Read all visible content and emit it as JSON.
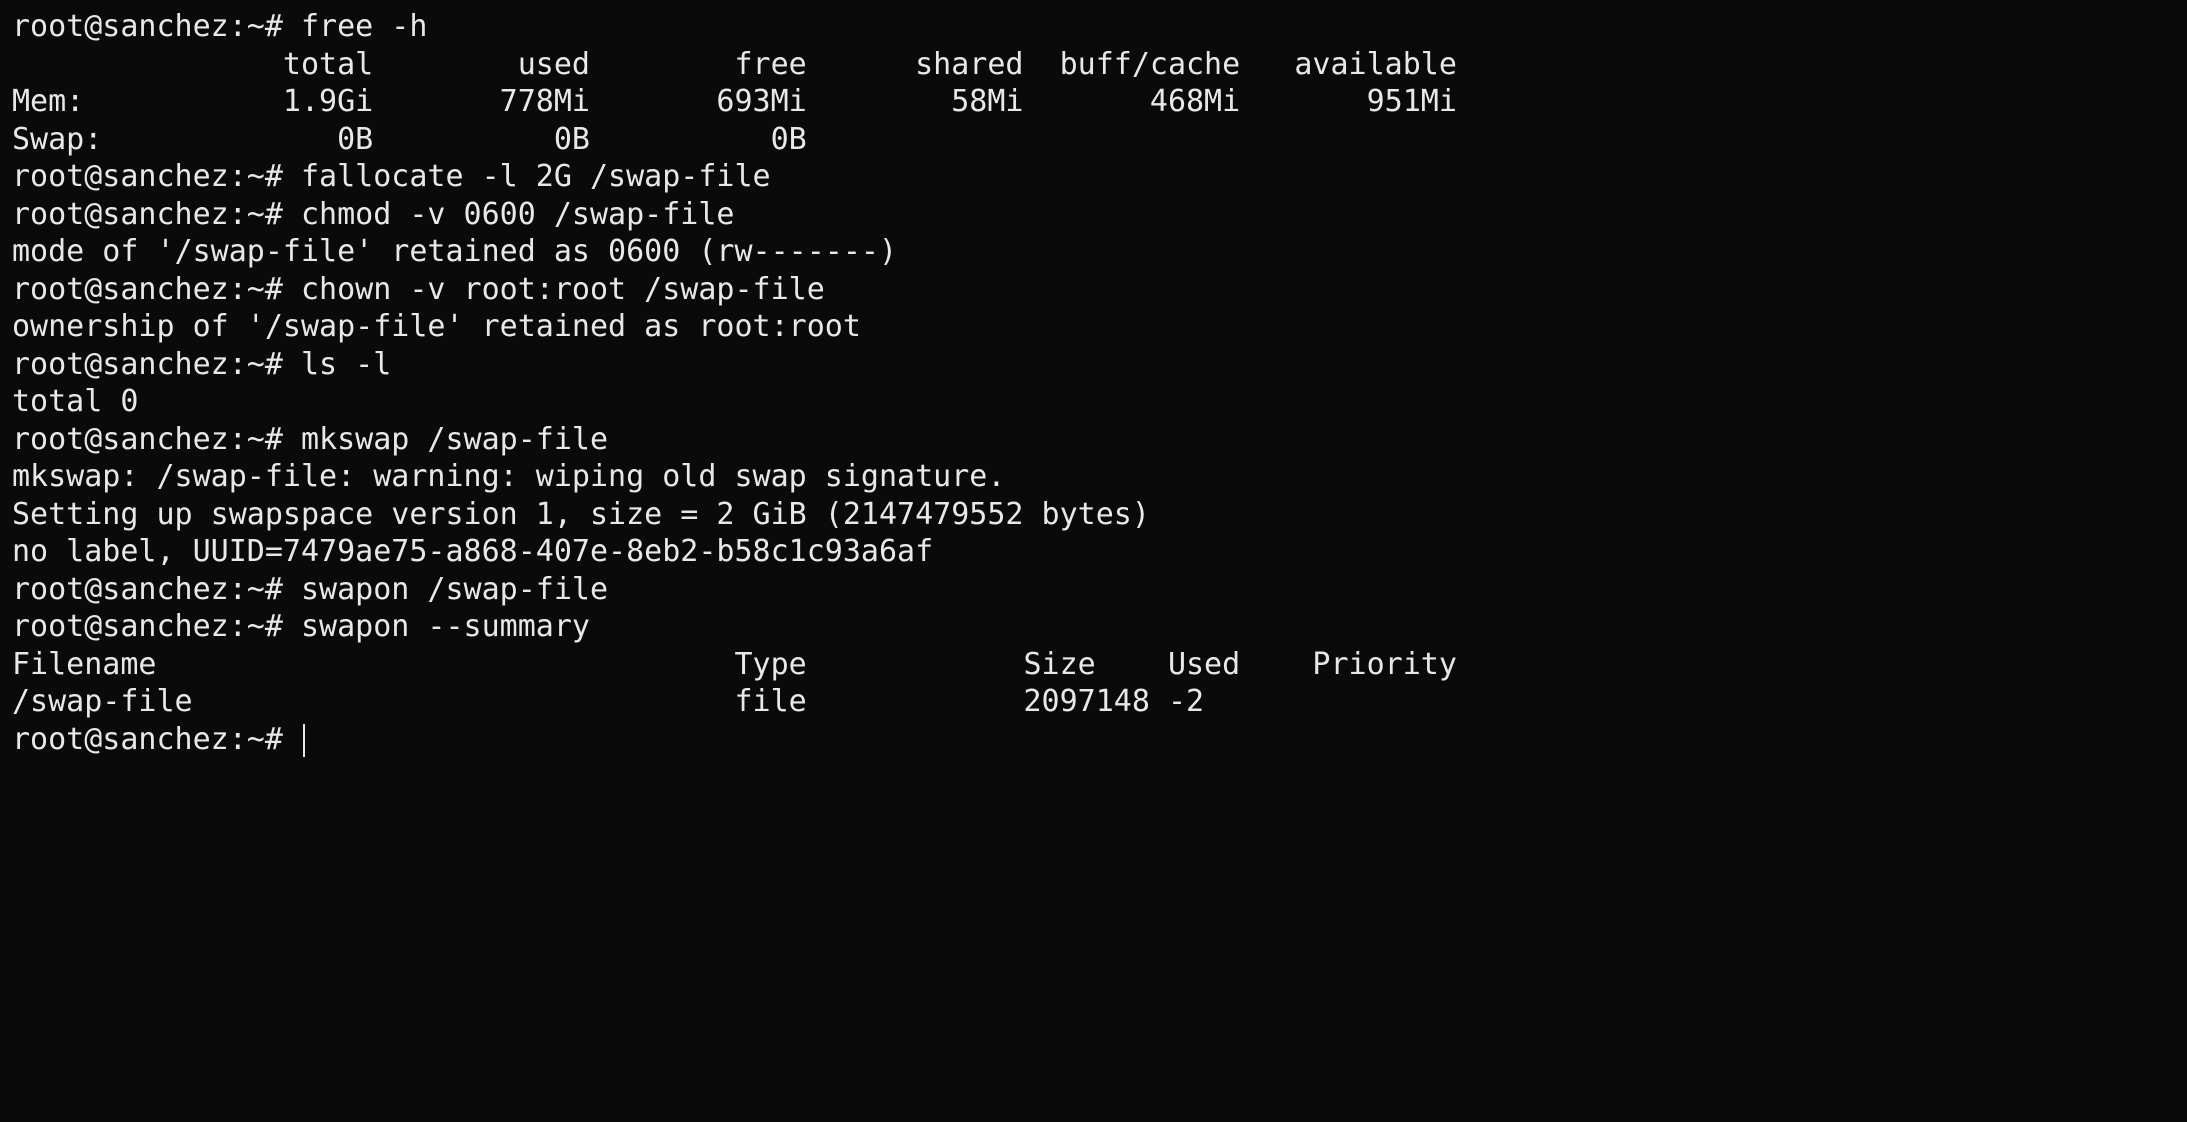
{
  "prompt": "root@sanchez:~# ",
  "commands": {
    "free": "free -h",
    "fallocate": "fallocate -l 2G /swap-file",
    "chmod": "chmod -v 0600 /swap-file",
    "chown": "chown -v root:root /swap-file",
    "ls": "ls -l",
    "mkswap": "mkswap /swap-file",
    "swapon": "swapon /swap-file",
    "swapon_summary": "swapon --summary"
  },
  "free_output": {
    "header": "               total        used        free      shared  buff/cache   available",
    "mem_row": "Mem:           1.9Gi       778Mi       693Mi        58Mi       468Mi       951Mi",
    "swap_row": "Swap:             0B          0B          0B",
    "parsed": {
      "columns": [
        "total",
        "used",
        "free",
        "shared",
        "buff/cache",
        "available"
      ],
      "rows": [
        {
          "name": "Mem:",
          "total": "1.9Gi",
          "used": "778Mi",
          "free": "693Mi",
          "shared": "58Mi",
          "buff_cache": "468Mi",
          "available": "951Mi"
        },
        {
          "name": "Swap:",
          "total": "0B",
          "used": "0B",
          "free": "0B",
          "shared": "",
          "buff_cache": "",
          "available": ""
        }
      ]
    }
  },
  "chmod_output": "mode of '/swap-file' retained as 0600 (rw-------)",
  "chown_output": "ownership of '/swap-file' retained as root:root",
  "ls_output": "total 0",
  "mkswap_output": {
    "line1": "mkswap: /swap-file: warning: wiping old swap signature.",
    "line2": "Setting up swapspace version 1, size = 2 GiB (2147479552 bytes)",
    "line3": "no label, UUID=7479ae75-a868-407e-8eb2-b58c1c93a6af"
  },
  "swapon_summary_output": {
    "header": "Filename                                Type            Size    Used    Priority",
    "row": "/swap-file                              file            2097148 -2",
    "parsed": {
      "columns": [
        "Filename",
        "Type",
        "Size",
        "Used",
        "Priority"
      ],
      "rows": [
        {
          "Filename": "/swap-file",
          "Type": "file",
          "Size": "2097148",
          "Used": "",
          "Priority": "-2"
        }
      ]
    }
  }
}
